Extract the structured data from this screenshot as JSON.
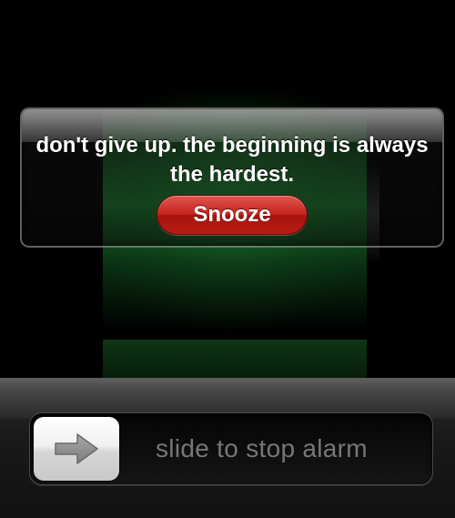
{
  "alarm": {
    "message": "don't give up. the beginning is always the hardest.",
    "snooze_label": "Snooze"
  },
  "lock_slider": {
    "label": "slide to stop alarm",
    "knob_icon": "right-arrow-icon"
  },
  "background": {
    "icon": "battery-charging-icon"
  },
  "colors": {
    "snooze_button": "#c4231a",
    "battery_glow": "#2e9a47",
    "slider_text": "#777777"
  }
}
